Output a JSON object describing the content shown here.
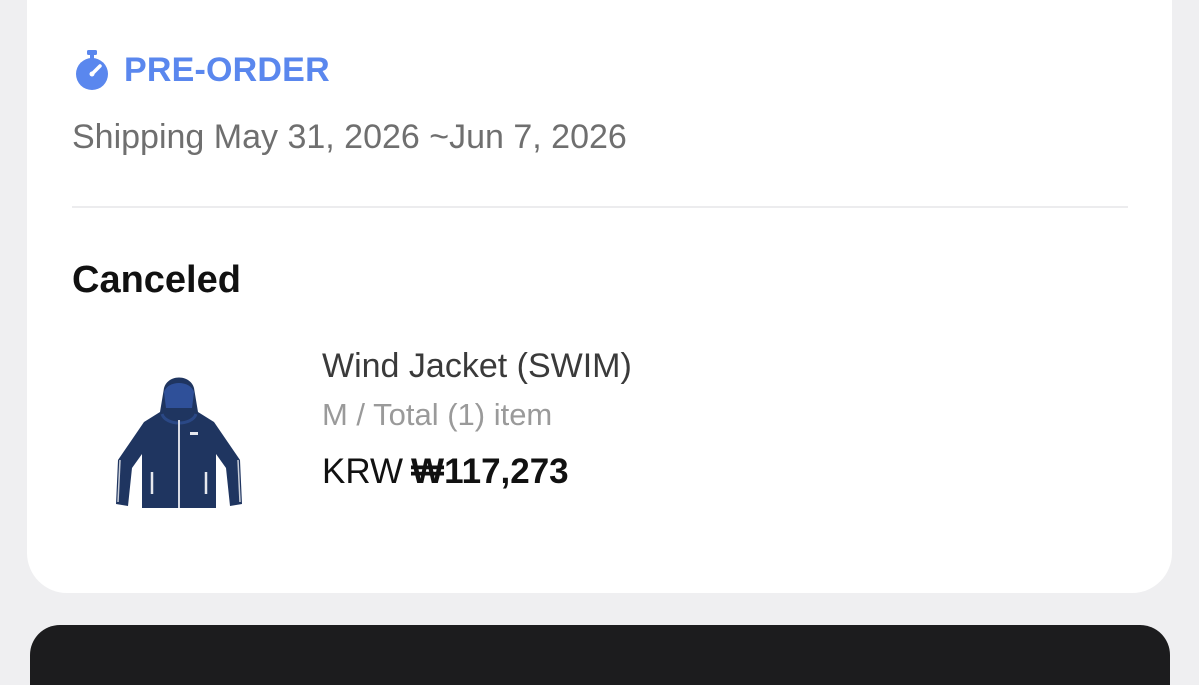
{
  "order": {
    "preorder_label": "PRE-ORDER",
    "shipping_text": "Shipping May 31, 2026 ~Jun 7, 2026",
    "status": "Canceled"
  },
  "product": {
    "name": "Wind Jacket (SWIM)",
    "meta": "M / Total (1) item",
    "price_currency": "KRW",
    "price_amount": "₩117,273",
    "image_icon": "navy-hooded-jacket-image"
  },
  "icons": {
    "preorder_icon": "stopwatch-icon"
  },
  "colors": {
    "accent": "#5a87ee",
    "jacket_navy": "#1f3560",
    "status_text": "#111111",
    "secondary_text": "#6f6f6f"
  }
}
